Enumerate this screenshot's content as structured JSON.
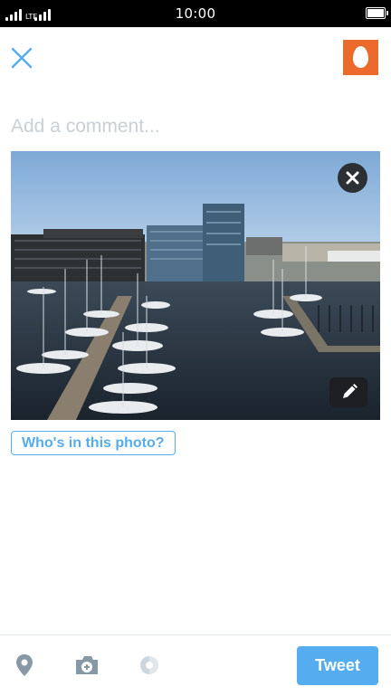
{
  "status_bar": {
    "time": "10:00",
    "network_label": "LTE"
  },
  "compose": {
    "comment_placeholder": "Add a comment...",
    "tag_people_label": "Who's in this photo?"
  },
  "toolbar": {
    "tweet_label": "Tweet"
  },
  "colors": {
    "accent": "#55acee",
    "avatar_bg": "#ec6a2c",
    "status_bar_bg": "#000000"
  },
  "icons": [
    "close-icon",
    "avatar-egg-icon",
    "remove-photo-icon",
    "edit-pencil-icon",
    "location-pin-icon",
    "camera-icon",
    "draft-icon",
    "signal-icon",
    "battery-icon"
  ]
}
